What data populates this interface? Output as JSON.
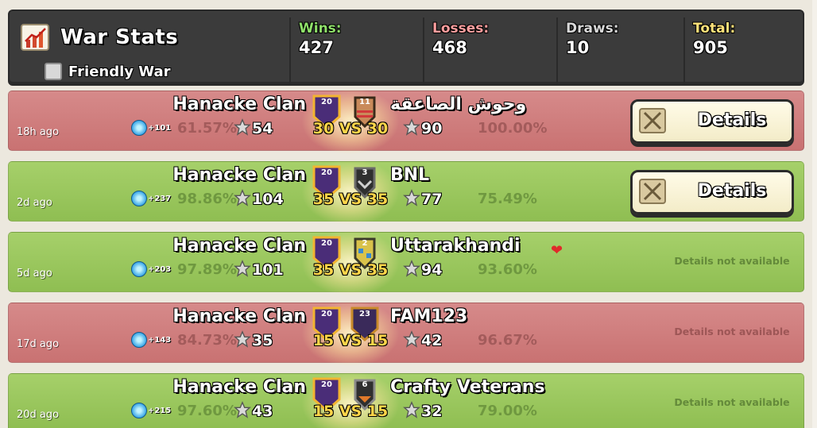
{
  "header": {
    "title": "War Stats",
    "friendly_label": "Friendly War",
    "friendly_checked": false,
    "stats": [
      {
        "label": "Wins:",
        "value": "427",
        "color": "#8fe06a"
      },
      {
        "label": "Losses:",
        "value": "468",
        "color": "#ff9f9f"
      },
      {
        "label": "Draws:",
        "value": "10",
        "color": "#d8d8d8"
      },
      {
        "label": "Total:",
        "value": "905",
        "color": "#ffe27a"
      }
    ]
  },
  "wars": [
    {
      "result": "loss",
      "ago": "18h ago",
      "clan_name": "Hanacke Clan",
      "clan_level": "20",
      "xp": "+101",
      "my_pct": "61.57%",
      "my_stars": "54",
      "vs": "30 VS 30",
      "opp_level": "11",
      "opp_name": "وحوش الصاعقة",
      "opp_stars": "90",
      "opp_pct": "100.00%",
      "details_label": "Details",
      "details_available": true
    },
    {
      "result": "win",
      "ago": "2d ago",
      "clan_name": "Hanacke Clan",
      "clan_level": "20",
      "xp": "+237",
      "my_pct": "98.86%",
      "my_stars": "104",
      "vs": "35 VS 35",
      "opp_level": "3",
      "opp_name": "BNL",
      "opp_stars": "77",
      "opp_pct": "75.49%",
      "details_label": "Details",
      "details_available": true
    },
    {
      "result": "win",
      "ago": "5d ago",
      "clan_name": "Hanacke Clan",
      "clan_level": "20",
      "xp": "+203",
      "my_pct": "97.89%",
      "my_stars": "101",
      "vs": "35 VS 35",
      "opp_level": "2",
      "opp_name": "Uttarakhandi",
      "opp_heart": "❤",
      "opp_stars": "94",
      "opp_pct": "93.60%",
      "details_label": "Details not available",
      "details_available": false
    },
    {
      "result": "loss",
      "ago": "17d ago",
      "clan_name": "Hanacke Clan",
      "clan_level": "20",
      "xp": "+143",
      "my_pct": "84.73%",
      "my_stars": "35",
      "vs": "15 VS 15",
      "opp_level": "23",
      "opp_name": "FAM123",
      "opp_stars": "42",
      "opp_pct": "96.67%",
      "details_label": "Details not available",
      "details_available": false
    },
    {
      "result": "win",
      "ago": "20d ago",
      "clan_name": "Hanacke Clan",
      "clan_level": "20",
      "xp": "+215",
      "my_pct": "97.60%",
      "my_stars": "43",
      "vs": "15 VS 15",
      "opp_level": "6",
      "opp_name": "Crafty Veterans",
      "opp_stars": "32",
      "opp_pct": "79.00%",
      "details_label": "Details not available",
      "details_available": false
    }
  ]
}
